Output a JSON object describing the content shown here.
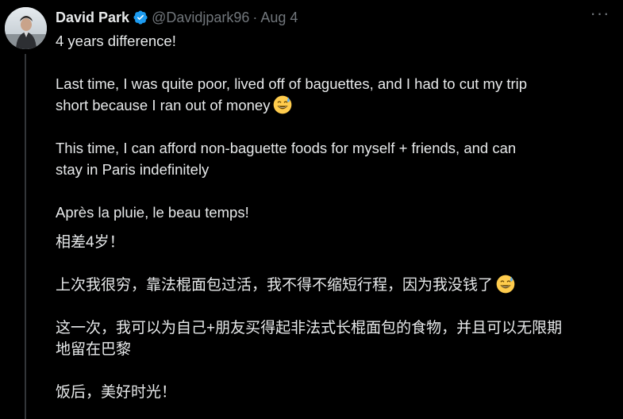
{
  "author": {
    "name": "David Park",
    "handle": "@Davidjpark96",
    "separator": "·",
    "date": "Aug 4"
  },
  "icons": {
    "verified": "verified-badge-icon",
    "more": "more-icon",
    "emoji": "grinning-face-with-sweat-emoji"
  },
  "more_label": "···",
  "colors": {
    "background": "#000000",
    "text": "#e7e9ea",
    "muted": "#71767b",
    "verified": "#1d9bf0",
    "thread_line": "#333639"
  },
  "tweet": {
    "en": {
      "line1": "4 years difference!",
      "para2_line1": "Last time, I was quite poor, lived off of baguettes, and I had to cut my trip",
      "para2_line2": "short because I ran out of money",
      "para3_line1": "This time, I can afford non-baguette foods for myself + friends, and can",
      "para3_line2": "stay in Paris indefinitely",
      "para4": "Après la pluie, le beau temps!"
    },
    "zh": {
      "line1": "相差4岁！",
      "line2": "上次我很穷，靠法棍面包过活，我不得不缩短行程，因为我没钱了",
      "line3a": "这一次，我可以为自己+朋友买得起非法式长棍面包的食物，并且可以无限期",
      "line3b": "地留在巴黎",
      "line4": "饭后，美好时光！"
    }
  }
}
